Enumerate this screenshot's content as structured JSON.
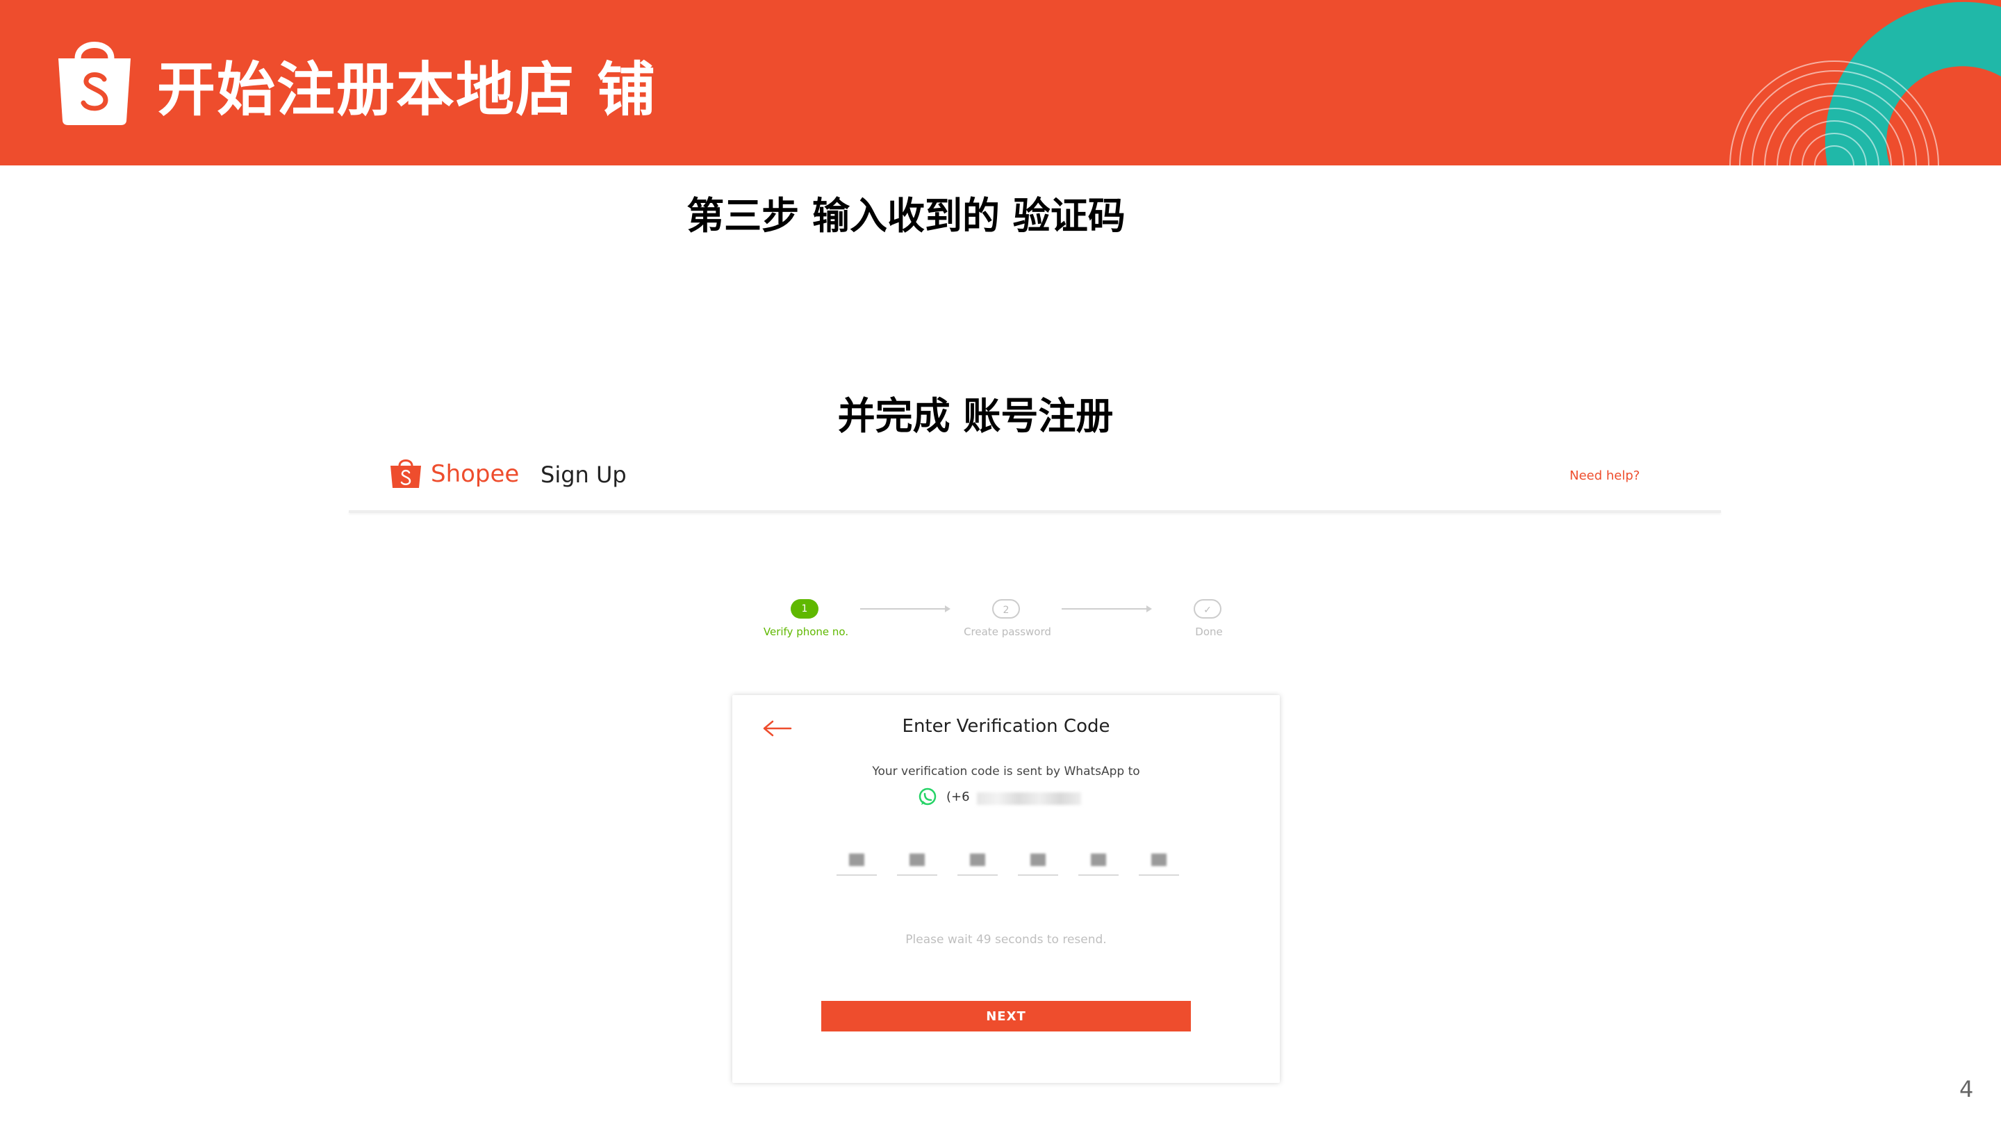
{
  "banner": {
    "title": "开始注册本地店 铺",
    "background_color": "#ee4d2d",
    "logo_icon": "shopee-bag-icon"
  },
  "headings": {
    "step3": "第三步 输入收到的 验证码",
    "complete": "并完成 账号注册"
  },
  "screenshot": {
    "header": {
      "brand": "Shopee",
      "page_title": "Sign Up",
      "help_link": "Need help?"
    },
    "stepper": {
      "steps": [
        {
          "number": "1",
          "label": "Verify phone no.",
          "state": "active"
        },
        {
          "number": "2",
          "label": "Create password",
          "state": "pending"
        },
        {
          "number": "✓",
          "label": "Done",
          "state": "pending"
        }
      ]
    },
    "card": {
      "title": "Enter Verification Code",
      "subtitle": "Your verification code is sent by WhatsApp to",
      "phone_prefix": "(+6",
      "otp_digits": [
        "",
        "",
        "",
        "",
        "",
        ""
      ],
      "resend_text": "Please wait 49 seconds to resend.",
      "next_button": "NEXT"
    }
  },
  "page_number": "4",
  "colors": {
    "brand": "#ee4d2d",
    "step_active": "#5fb800",
    "teal_accent": "#20b8a8"
  }
}
